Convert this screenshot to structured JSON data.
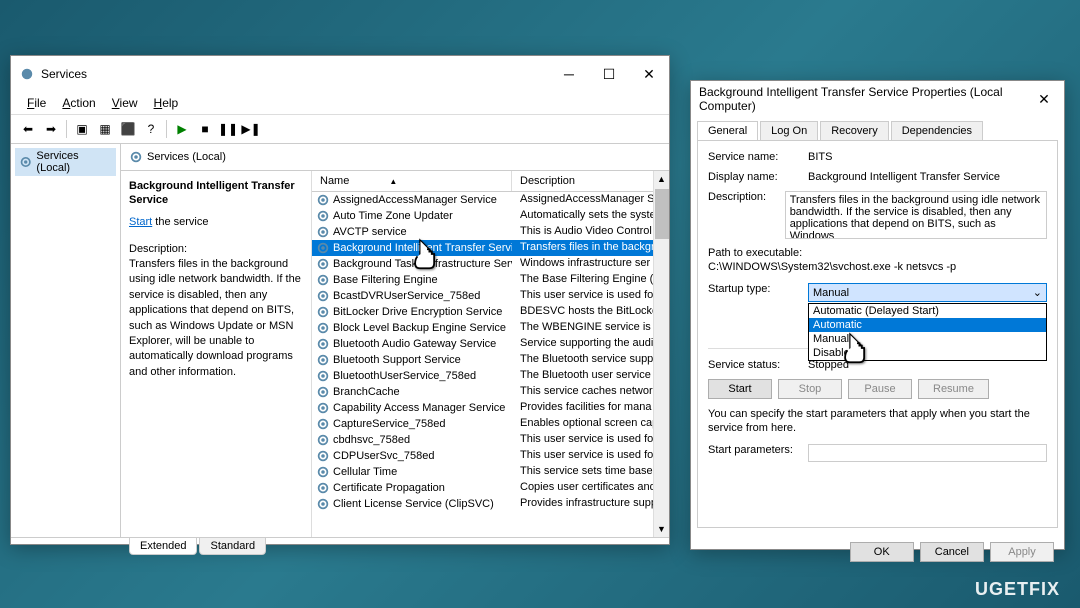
{
  "services_window": {
    "title": "Services",
    "menu": {
      "file": "File",
      "action": "Action",
      "view": "View",
      "help": "Help"
    },
    "tree": {
      "root": "Services (Local)"
    },
    "header": "Services (Local)",
    "info": {
      "title": "Background Intelligent Transfer Service",
      "start_link": "Start",
      "start_suffix": " the service",
      "desc_label": "Description:",
      "desc_text": "Transfers files in the background using idle network bandwidth. If the service is disabled, then any applications that depend on BITS, such as Windows Update or MSN Explorer, will be unable to automatically download programs and other information."
    },
    "columns": {
      "name": "Name",
      "desc": "Description"
    },
    "services": [
      {
        "name": "AssignedAccessManager Service",
        "desc": "AssignedAccessManager Se"
      },
      {
        "name": "Auto Time Zone Updater",
        "desc": "Automatically sets the syste"
      },
      {
        "name": "AVCTP service",
        "desc": "This is Audio Video Control"
      },
      {
        "name": "Background Intelligent Transfer Service",
        "desc": "Transfers files in the backgr",
        "selected": true
      },
      {
        "name": "Background Tasks Infrastructure Service",
        "desc": "Windows infrastructure ser"
      },
      {
        "name": "Base Filtering Engine",
        "desc": "The Base Filtering Engine (B"
      },
      {
        "name": "BcastDVRUserService_758ed",
        "desc": "This user service is used for"
      },
      {
        "name": "BitLocker Drive Encryption Service",
        "desc": "BDESVC hosts the BitLocker"
      },
      {
        "name": "Block Level Backup Engine Service",
        "desc": "The WBENGINE service is us"
      },
      {
        "name": "Bluetooth Audio Gateway Service",
        "desc": "Service supporting the audi"
      },
      {
        "name": "Bluetooth Support Service",
        "desc": "The Bluetooth service suppo"
      },
      {
        "name": "BluetoothUserService_758ed",
        "desc": "The Bluetooth user service s"
      },
      {
        "name": "BranchCache",
        "desc": "This service caches network"
      },
      {
        "name": "Capability Access Manager Service",
        "desc": "Provides facilities for mana"
      },
      {
        "name": "CaptureService_758ed",
        "desc": "Enables optional screen cap"
      },
      {
        "name": "cbdhsvc_758ed",
        "desc": "This user service is used for"
      },
      {
        "name": "CDPUserSvc_758ed",
        "desc": "This user service is used for"
      },
      {
        "name": "Cellular Time",
        "desc": "This service sets time based"
      },
      {
        "name": "Certificate Propagation",
        "desc": "Copies user certificates and"
      },
      {
        "name": "Client License Service (ClipSVC)",
        "desc": "Provides infrastructure supp"
      }
    ],
    "tabs": {
      "extended": "Extended",
      "standard": "Standard"
    }
  },
  "props_window": {
    "title": "Background Intelligent Transfer Service Properties (Local Computer)",
    "tabs": {
      "general": "General",
      "logon": "Log On",
      "recovery": "Recovery",
      "deps": "Dependencies"
    },
    "labels": {
      "service_name": "Service name:",
      "display_name": "Display name:",
      "description": "Description:",
      "path": "Path to executable:",
      "startup_type": "Startup type:",
      "service_status": "Service status:",
      "start_params": "Start parameters:"
    },
    "values": {
      "service_name": "BITS",
      "display_name": "Background Intelligent Transfer Service",
      "description": "Transfers files in the background using idle network bandwidth. If the service is disabled, then any applications that depend on BITS, such as Windows",
      "path": "C:\\WINDOWS\\System32\\svchost.exe -k netsvcs -p",
      "startup_selected": "Manual",
      "service_status": "Stopped",
      "start_params": ""
    },
    "dropdown_options": [
      "Automatic (Delayed Start)",
      "Automatic",
      "Manual",
      "Disabled"
    ],
    "dropdown_highlighted": "Automatic",
    "buttons": {
      "start": "Start",
      "stop": "Stop",
      "pause": "Pause",
      "resume": "Resume"
    },
    "hint": "You can specify the start parameters that apply when you start the service from here.",
    "dialog_buttons": {
      "ok": "OK",
      "cancel": "Cancel",
      "apply": "Apply"
    }
  },
  "watermark": "UGETFIX"
}
